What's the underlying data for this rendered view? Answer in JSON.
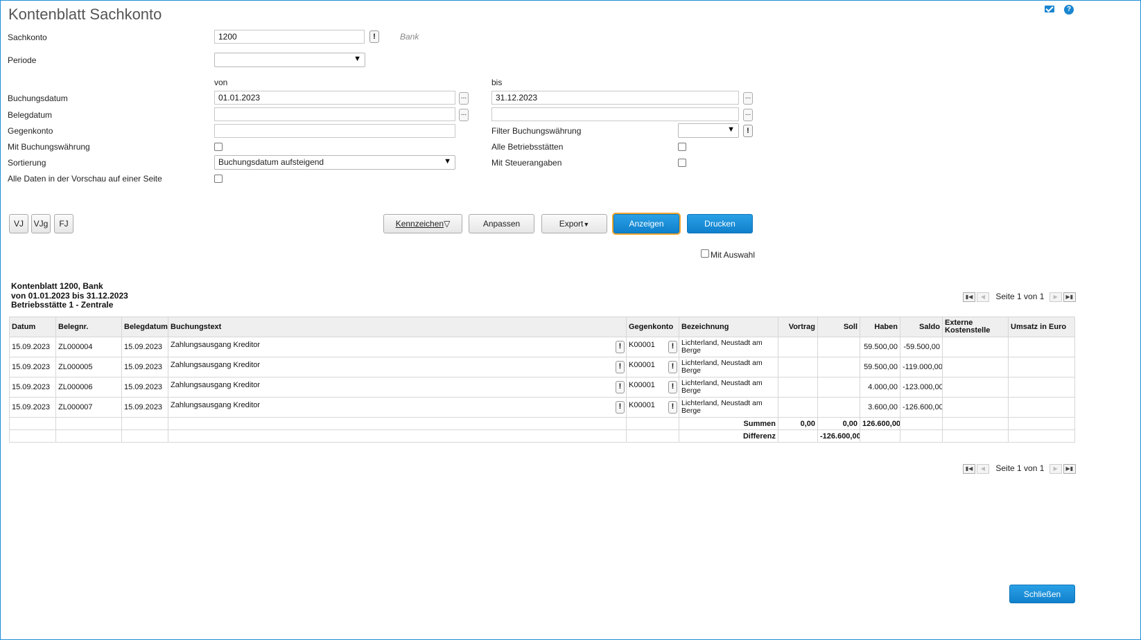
{
  "window": {
    "title": "Kontenblatt Sachkonto"
  },
  "icons": {
    "mail": "mail-icon",
    "help": "help-icon"
  },
  "form": {
    "sachkonto": {
      "label": "Sachkonto",
      "value": "1200",
      "name_hint": "Bank",
      "alert": "!"
    },
    "periode": {
      "label": "Periode",
      "value": ""
    },
    "range_headers": {
      "von": "von",
      "bis": "bis"
    },
    "buchungsdatum": {
      "label": "Buchungsdatum",
      "von": "01.01.2023",
      "bis": "31.12.2023"
    },
    "belegdatum": {
      "label": "Belegdatum",
      "von": "",
      "bis": ""
    },
    "gegenkonto": {
      "label": "Gegenkonto",
      "value": ""
    },
    "filter_buchungswaehrung": {
      "label": "Filter Buchungswährung",
      "value": "",
      "alert": "!"
    },
    "mit_buchungswaehrung": {
      "label": "Mit Buchungswährung",
      "checked": false
    },
    "alle_betriebsstaetten": {
      "label": "Alle Betriebsstätten",
      "checked": false
    },
    "sortierung": {
      "label": "Sortierung",
      "value": "Buchungsdatum aufsteigend"
    },
    "mit_steuerangaben": {
      "label": "Mit Steuerangaben",
      "checked": false
    },
    "alle_daten": {
      "label": "Alle Daten in der Vorschau auf einer Seite",
      "checked": false
    },
    "dots": "..."
  },
  "buttons": {
    "vj": "VJ",
    "vjg": "VJg",
    "fj": "FJ",
    "kennzeichen": "Kennzeichen",
    "anpassen": "Anpassen",
    "export": "Export",
    "anzeigen": "Anzeigen",
    "drucken": "Drucken",
    "mit_auswahl": "Mit Auswahl",
    "schliessen": "Schließen"
  },
  "report": {
    "line1": "Kontenblatt 1200, Bank",
    "line2": "von 01.01.2023 bis 31.12.2023",
    "line3": "Betriebsstätte 1 - Zentrale",
    "pager_text": "Seite 1 von 1",
    "columns": {
      "datum": "Datum",
      "belegnr": "Belegnr.",
      "belegdatum": "Belegdatum",
      "buchungstext": "Buchungstext",
      "gegenkonto": "Gegenkonto",
      "bezeichnung": "Bezeichnung",
      "vortrag": "Vortrag",
      "soll": "Soll",
      "haben": "Haben",
      "saldo": "Saldo",
      "externe_kostenstelle": "Externe Kostenstelle",
      "umsatz_euro": "Umsatz in Euro"
    },
    "rows": [
      {
        "datum": "15.09.2023",
        "belegnr": "ZL000004",
        "belegdatum": "15.09.2023",
        "buchungstext": "Zahlungsausgang Kreditor",
        "gegenkonto": "K00001",
        "bezeichnung": "Lichterland, Neustadt am Berge",
        "vortrag": "",
        "soll": "",
        "haben": "59.500,00",
        "saldo": "-59.500,00"
      },
      {
        "datum": "15.09.2023",
        "belegnr": "ZL000005",
        "belegdatum": "15.09.2023",
        "buchungstext": "Zahlungsausgang Kreditor",
        "gegenkonto": "K00001",
        "bezeichnung": "Lichterland, Neustadt am Berge",
        "vortrag": "",
        "soll": "",
        "haben": "59.500,00",
        "saldo": "-119.000,00"
      },
      {
        "datum": "15.09.2023",
        "belegnr": "ZL000006",
        "belegdatum": "15.09.2023",
        "buchungstext": "Zahlungsausgang Kreditor",
        "gegenkonto": "K00001",
        "bezeichnung": "Lichterland, Neustadt am Berge",
        "vortrag": "",
        "soll": "",
        "haben": "4.000,00",
        "saldo": "-123.000,00"
      },
      {
        "datum": "15.09.2023",
        "belegnr": "ZL000007",
        "belegdatum": "15.09.2023",
        "buchungstext": "Zahlungsausgang Kreditor",
        "gegenkonto": "K00001",
        "bezeichnung": "Lichterland, Neustadt am Berge",
        "vortrag": "",
        "soll": "",
        "haben": "3.600,00",
        "saldo": "-126.600,00"
      }
    ],
    "summen": {
      "label": "Summen",
      "vortrag": "0,00",
      "soll": "0,00",
      "haben": "126.600,00"
    },
    "differenz": {
      "label": "Differenz",
      "soll": "-126.600,00"
    },
    "alert": "!"
  }
}
